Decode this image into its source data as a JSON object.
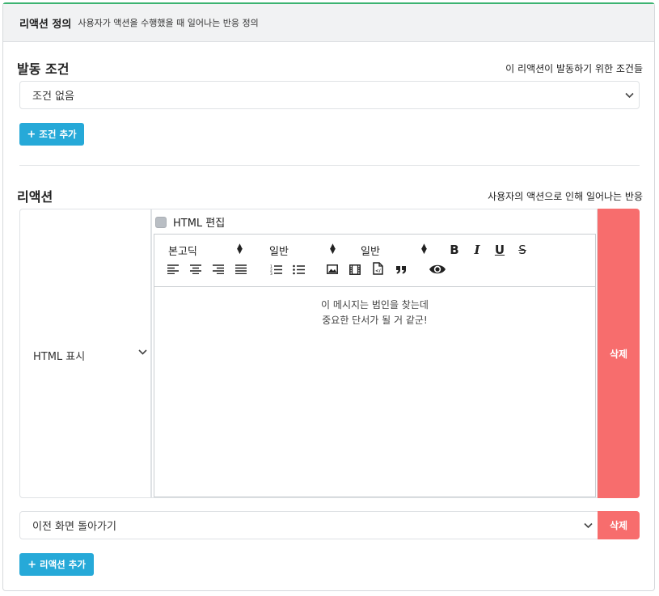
{
  "header": {
    "title": "리액션 정의",
    "subtitle": "사용자가 액션을 수행했을 때 일어나는 반응 정의"
  },
  "trigger": {
    "title": "발동 조건",
    "hint": "이 리액션이 발동하기 위한 조건들",
    "select_value": "조건 없음",
    "add_button": "조건 추가"
  },
  "reaction": {
    "title": "리액션",
    "hint": "사용자의 액션으로 인해 일어나는 반응",
    "action_type": "HTML 표시",
    "html_edit_label": "HTML 편집",
    "toolbar": {
      "font": "본고딕",
      "size": "일반",
      "heading": "일반",
      "bold": "B",
      "italic": "I",
      "underline": "U",
      "strike": "S"
    },
    "content_lines": [
      "이 메시지는 범인을 찾는데",
      "중요한 단서가 될 거 같군!"
    ],
    "delete_button": "삭제"
  },
  "second_action": {
    "select_value": "이전 화면 돌아가기",
    "delete_button": "삭제"
  },
  "add_reaction_button": "리액션 추가",
  "colors": {
    "accent_blue": "#26a9d8",
    "danger_red": "#f76d6d",
    "top_border_green": "#3cb371"
  }
}
